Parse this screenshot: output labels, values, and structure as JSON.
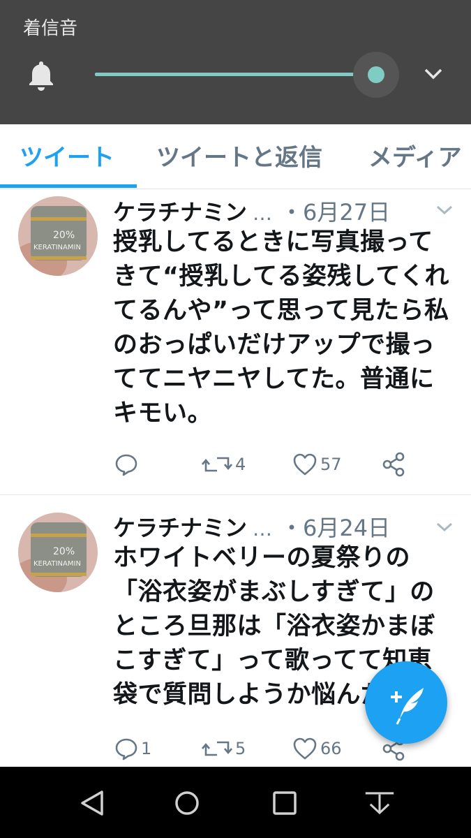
{
  "volume": {
    "title": "着信音",
    "level": 1.0,
    "accent_color": "#80cbc4",
    "icon": "bell-icon",
    "expand_icon": "chevron-down-icon"
  },
  "tabs": [
    {
      "label": "ツイート",
      "active": true
    },
    {
      "label": "ツイートと返信",
      "active": false
    },
    {
      "label": "メディア",
      "active": false
    }
  ],
  "tweets": [
    {
      "author": "ケラチナミン",
      "ellipsis": "…",
      "date": "・6月27日",
      "lines": [
        "授乳してるときに写真撮って",
        "きて“授乳してる姿残してくれ",
        "てるんや”って思って見たら私",
        "のおっぱいだけアップで撮っ",
        "ててニヤニヤしてた。普通に",
        "キモい。"
      ],
      "replies": "",
      "retweets": "4",
      "likes": "57"
    },
    {
      "author": "ケラチナミン",
      "ellipsis": "…",
      "date": "・6月24日",
      "lines": [
        "ホワイトベリーの夏祭りの",
        "「浴衣姿がまぶしすぎて」の",
        "ところ旦那は「浴衣姿かまぼ",
        "こすぎて」って歌ってて知恵",
        "袋で質問しようか悩んだ"
      ],
      "replies": "1",
      "retweets": "5",
      "likes": "66"
    }
  ],
  "avatar": {
    "product_text_1": "20%",
    "product_text_2": "KERATINAMIN"
  },
  "colors": {
    "accent": "#1da1f2",
    "muted": "#657786",
    "text": "#14171a"
  },
  "navigation": [
    "back-icon",
    "home-icon",
    "recents-icon",
    "keyboard-hide-icon"
  ],
  "fab_icon": "compose-tweet-icon"
}
